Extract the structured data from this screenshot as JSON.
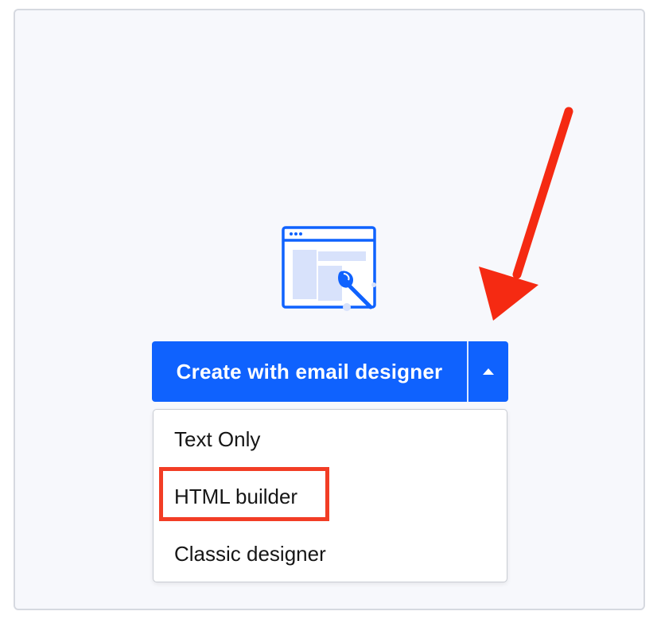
{
  "main_button": {
    "label": "Create with email designer",
    "color": "#0f62fe",
    "toggle_icon": "caret-up-icon"
  },
  "dropdown": {
    "items": [
      {
        "label": "Text Only"
      },
      {
        "label": "HTML builder"
      },
      {
        "label": "Classic designer"
      }
    ]
  },
  "annotations": {
    "highlight_color": "#f23d25",
    "arrow_color": "#f52a12"
  },
  "icons": {
    "illustration": "email-designer-illustration-icon"
  }
}
